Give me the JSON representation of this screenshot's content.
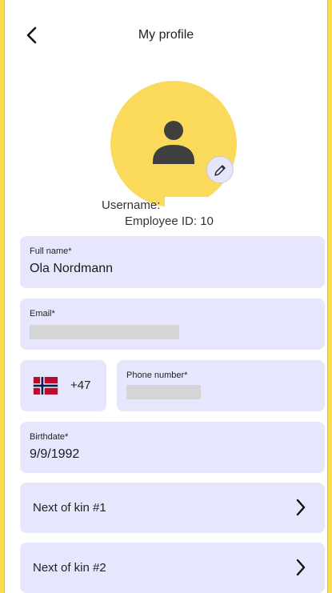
{
  "header": {
    "title": "My profile"
  },
  "profile": {
    "username_label": "Username:",
    "employee_id_text": "Employee ID: 10"
  },
  "fields": {
    "full_name": {
      "label": "Full name*",
      "value": "Ola Nordmann"
    },
    "email": {
      "label": "Email*"
    },
    "phone": {
      "dial_code": "+47",
      "label": "Phone number*"
    },
    "birthdate": {
      "label": "Birthdate*",
      "value": "9/9/1992"
    }
  },
  "next_of_kin": [
    {
      "label": "Next of kin #1"
    },
    {
      "label": "Next of kin #2"
    }
  ],
  "icons": {
    "back": "chevron-left-icon",
    "avatar": "person-icon",
    "edit": "pencil-icon",
    "flag": "norway-flag-icon",
    "row_arrow": "chevron-right-icon"
  },
  "colors": {
    "accent_yellow": "#fbdc4e",
    "field_background": "#e6e7fc",
    "edit_button": "#e4e6fa"
  }
}
